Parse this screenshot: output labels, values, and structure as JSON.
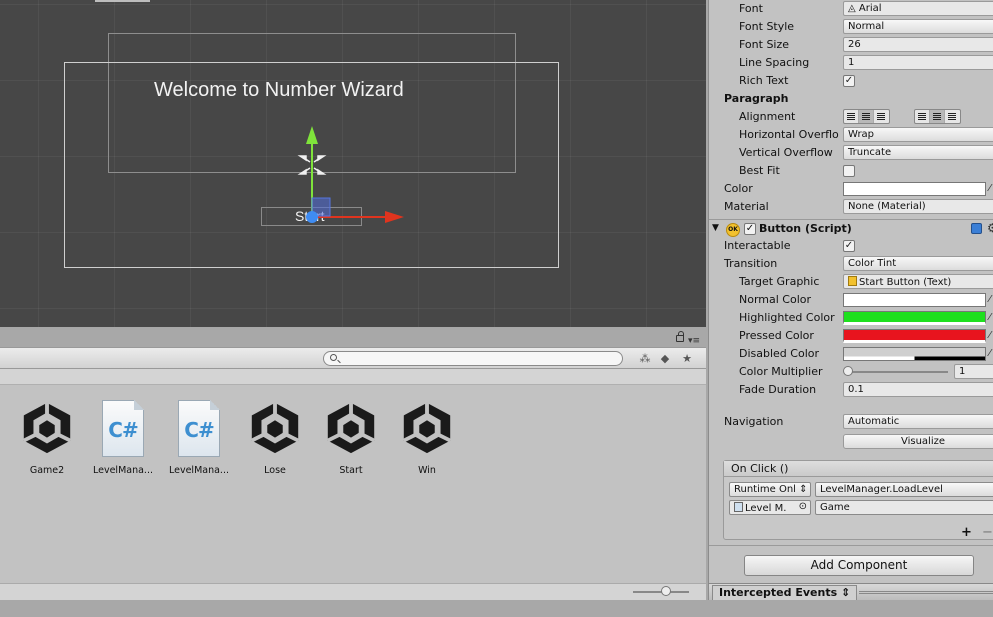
{
  "scene": {
    "welcome_text": "Welcome to Number Wizard",
    "start_text": "Start"
  },
  "project": {
    "assets": [
      {
        "label": "Game2",
        "kind": "unity"
      },
      {
        "label": "LevelMana...",
        "kind": "csharp"
      },
      {
        "label": "LevelMana...",
        "kind": "csharp"
      },
      {
        "label": "Lose",
        "kind": "unity"
      },
      {
        "label": "Start",
        "kind": "unity"
      },
      {
        "label": "Win",
        "kind": "unity"
      }
    ],
    "cs_glyph": "C#"
  },
  "inspector": {
    "text": {
      "font_label": "Font",
      "font_value": "Arial",
      "font_style_label": "Font Style",
      "font_style_value": "Normal",
      "font_size_label": "Font Size",
      "font_size_value": "26",
      "line_spacing_label": "Line Spacing",
      "line_spacing_value": "1",
      "rich_text_label": "Rich Text",
      "paragraph_label": "Paragraph",
      "alignment_label": "Alignment",
      "horizontal_overflow_label": "Horizontal Overflo",
      "horizontal_overflow_value": "Wrap",
      "vertical_overflow_label": "Vertical Overflow",
      "vertical_overflow_value": "Truncate",
      "best_fit_label": "Best Fit",
      "color_label": "Color",
      "material_label": "Material",
      "material_value": "None (Material)"
    },
    "button": {
      "title": "Button (Script)",
      "ok_badge": "OK",
      "interactable_label": "Interactable",
      "transition_label": "Transition",
      "transition_value": "Color Tint",
      "target_graphic_label": "Target Graphic",
      "target_graphic_value": "Start Button (Text)",
      "normal_color_label": "Normal Color",
      "highlighted_color_label": "Highlighted Color",
      "pressed_color_label": "Pressed Color",
      "disabled_color_label": "Disabled Color",
      "color_multiplier_label": "Color Multiplier",
      "color_multiplier_value": "1",
      "fade_duration_label": "Fade Duration",
      "fade_duration_value": "0.1",
      "navigation_label": "Navigation",
      "navigation_value": "Automatic",
      "visualize_label": "Visualize"
    },
    "onclick": {
      "title": "On Click ()",
      "runtime_value": "Runtime Onl",
      "function_value": "LevelManager.LoadLevel",
      "object_value": "Level M.",
      "argument_value": "Game",
      "plus": "+",
      "minus": "−"
    },
    "add_component_label": "Add Component"
  },
  "footer": {
    "intercepted_events_label": "Intercepted Events"
  },
  "colors": {
    "normal": "#ffffff",
    "highlighted": "#1ee01e",
    "pressed": "#e8141e",
    "text_color": "#ffffff"
  }
}
